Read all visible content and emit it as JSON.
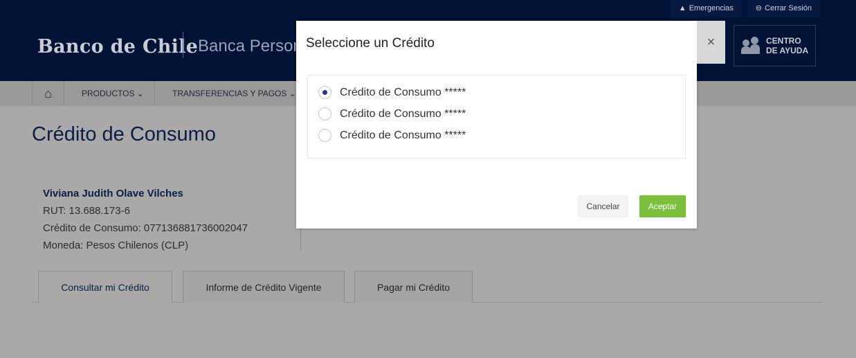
{
  "header": {
    "utility_links": [
      {
        "label": "Emergencias",
        "icon": "warning-icon"
      },
      {
        "label": "Cerrar Sesión",
        "icon": "logout-icon"
      }
    ],
    "logo_text": "Banco de Chile",
    "section_title": "Banca Personas",
    "help_button": {
      "line1": "CENTRO",
      "line2": "DE AYUDA",
      "icon": "people-icon"
    }
  },
  "nav": {
    "home_icon": "home-icon",
    "items": [
      {
        "label": "PRODUCTOS ⌄"
      },
      {
        "label": "TRANSFERENCIAS Y PAGOS ⌄"
      }
    ]
  },
  "page": {
    "title": "Crédito de Consumo",
    "customer": {
      "name": "Viviana Judith Olave Vilches",
      "rut": "RUT: 13.688.173-6",
      "credit": "Crédito de Consumo: 077136881736002047",
      "currency": "Moneda: Pesos Chilenos (CLP)"
    },
    "tabs": [
      {
        "label": "Consultar mi Crédito",
        "active": true
      },
      {
        "label": "Informe de Crédito Vigente",
        "active": false
      },
      {
        "label": "Pagar mi Crédito",
        "active": false
      }
    ]
  },
  "modal": {
    "title": "Seleccione un Crédito",
    "close_symbol": "×",
    "options": [
      {
        "label": "Crédito de Consumo *****",
        "selected": true
      },
      {
        "label": "Crédito de Consumo *****",
        "selected": false
      },
      {
        "label": "Crédito de Consumo *****",
        "selected": false
      }
    ],
    "cancel_label": "Cancelar",
    "accept_label": "Aceptar"
  },
  "colors": {
    "header_bg": "#001235",
    "accept_green": "#7cbf3f",
    "title_blue": "#0b1d45",
    "radio_selected": "#1d3a8a"
  }
}
